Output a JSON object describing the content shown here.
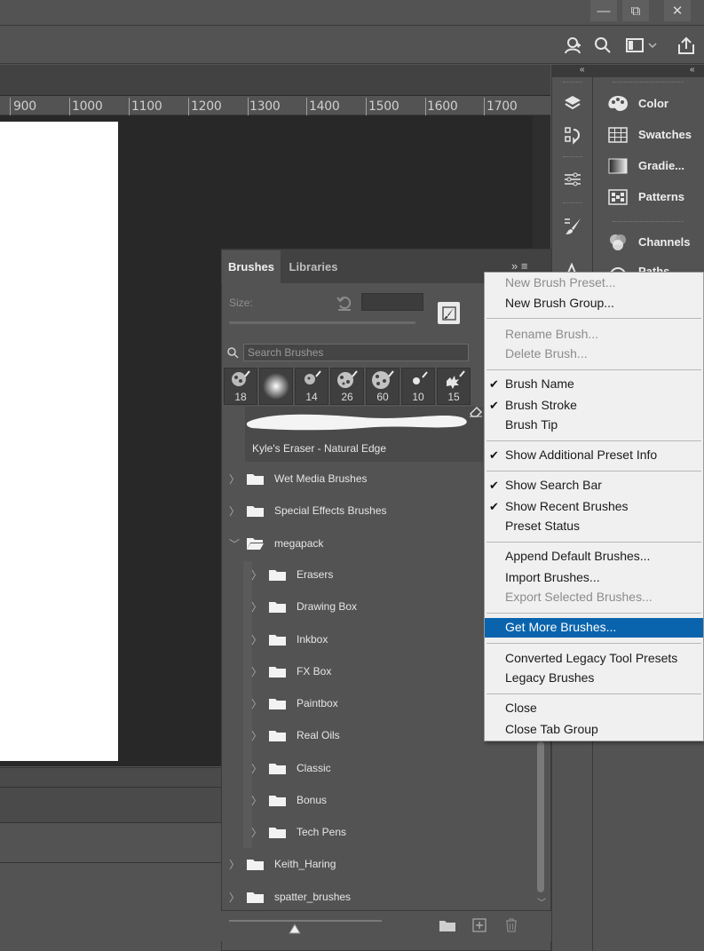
{
  "window": {
    "min_glyph": "—",
    "restore_glyph": "⧉",
    "close_glyph": "✕"
  },
  "ruler": {
    "ticks": [
      "900",
      "1000",
      "1100",
      "1200",
      "1300",
      "1400",
      "1500",
      "1600",
      "1700"
    ]
  },
  "right_named_panels": {
    "items": [
      "Color",
      "Swatches",
      "Gradie...",
      "Patterns",
      "Channels",
      "Paths"
    ]
  },
  "brushes_panel": {
    "tabs": [
      "Brushes",
      "Libraries"
    ],
    "menu_glyph": "»  ≡",
    "size_label": "Size:",
    "size_value": "",
    "search_placeholder": "Search Brushes",
    "recent_brushes": [
      "18",
      "",
      "14",
      "26",
      "60",
      "10",
      "15"
    ],
    "selected_preset": "Kyle's Eraser - Natural Edge",
    "folders": [
      {
        "label": "Wet Media Brushes",
        "expanded": false,
        "level": 0
      },
      {
        "label": "Special Effects Brushes",
        "expanded": false,
        "level": 0
      },
      {
        "label": "megapack",
        "expanded": true,
        "level": 0
      },
      {
        "label": "Erasers",
        "expanded": false,
        "level": 1
      },
      {
        "label": "Drawing Box",
        "expanded": false,
        "level": 1
      },
      {
        "label": "Inkbox",
        "expanded": false,
        "level": 1
      },
      {
        "label": "FX Box",
        "expanded": false,
        "level": 1
      },
      {
        "label": "Paintbox",
        "expanded": false,
        "level": 1
      },
      {
        "label": "Real Oils",
        "expanded": false,
        "level": 1
      },
      {
        "label": "Classic",
        "expanded": false,
        "level": 1
      },
      {
        "label": "Bonus",
        "expanded": false,
        "level": 1
      },
      {
        "label": "Tech Pens",
        "expanded": false,
        "level": 1
      },
      {
        "label": "Keith_Haring",
        "expanded": false,
        "level": 0
      },
      {
        "label": "spatter_brushes",
        "expanded": false,
        "level": 0
      }
    ]
  },
  "context_menu": {
    "items": [
      {
        "label": "New Brush Preset...",
        "disabled": true,
        "checked": false
      },
      {
        "label": "New Brush Group...",
        "disabled": false,
        "checked": false
      },
      {
        "label": "Rename Brush...",
        "disabled": true,
        "checked": false
      },
      {
        "label": "Delete Brush...",
        "disabled": true,
        "checked": false
      },
      {
        "label": "Brush Name",
        "disabled": false,
        "checked": true
      },
      {
        "label": "Brush Stroke",
        "disabled": false,
        "checked": true
      },
      {
        "label": "Brush Tip",
        "disabled": false,
        "checked": false
      },
      {
        "label": "Show Additional Preset Info",
        "disabled": false,
        "checked": true
      },
      {
        "label": "Show Search Bar",
        "disabled": false,
        "checked": true
      },
      {
        "label": "Show Recent Brushes",
        "disabled": false,
        "checked": true
      },
      {
        "label": "Preset Status",
        "disabled": false,
        "checked": false
      },
      {
        "label": "Append Default Brushes...",
        "disabled": false,
        "checked": false
      },
      {
        "label": "Import Brushes...",
        "disabled": false,
        "checked": false
      },
      {
        "label": "Export Selected Brushes...",
        "disabled": true,
        "checked": false
      },
      {
        "label": "Get More Brushes...",
        "disabled": false,
        "checked": false,
        "highlighted": true
      },
      {
        "label": "Converted Legacy Tool Presets",
        "disabled": false,
        "checked": false
      },
      {
        "label": "Legacy Brushes",
        "disabled": false,
        "checked": false
      },
      {
        "label": "Close",
        "disabled": false,
        "checked": false
      },
      {
        "label": "Close Tab Group",
        "disabled": false,
        "checked": false
      }
    ],
    "check_glyph": "✔",
    "highlight_color": "#0a64ad"
  },
  "colors": {
    "app_bg": "#535353",
    "canvas_bg": "#282828",
    "menu_bg": "#f0f0f0",
    "accent": "#0a64ad"
  }
}
